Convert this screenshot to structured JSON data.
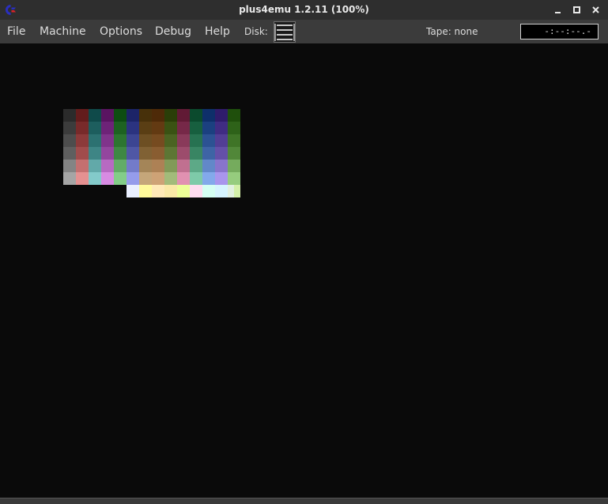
{
  "window": {
    "title": "plus4emu 1.2.11 (100%)",
    "app_icon": "commodore-logo-icon",
    "buttons": [
      "minimize-icon",
      "maximize-icon",
      "close-icon"
    ]
  },
  "menu": {
    "items": [
      {
        "label": "File"
      },
      {
        "label": "Machine"
      },
      {
        "label": "Options"
      },
      {
        "label": "Debug"
      },
      {
        "label": "Help"
      }
    ],
    "disk_label": "Disk:",
    "tape_label": "Tape: none",
    "tape_counter": "-:--:--.-"
  },
  "colors": {
    "titlebar": "#2e2e2e",
    "menubar": "#3b3b3b",
    "screen_background": "#0a0a0a"
  },
  "palette": {
    "rows": [
      [
        "#2b2b2b",
        "#631c1c",
        "#0f4a4a",
        "#5a1461",
        "#0d4d12",
        "#1c2468",
        "#47300a",
        "#4e2a08",
        "#2a3e08",
        "#611a35",
        "#0b4a2d",
        "#0e2f6a",
        "#2f1c6b",
        "#1f4f0c"
      ],
      [
        "#3c3c3c",
        "#782a2a",
        "#1d5e5e",
        "#6e2378",
        "#1d6221",
        "#2b3380",
        "#5a3e14",
        "#633a12",
        "#3a5213",
        "#762848",
        "#175f3f",
        "#1b4080",
        "#402c83",
        "#2e6219"
      ],
      [
        "#4d4d4d",
        "#8c3a3a",
        "#2c7171",
        "#80348b",
        "#2c7530",
        "#3c4592",
        "#6d4f23",
        "#764b20",
        "#4b6322",
        "#893a5a",
        "#277251",
        "#2c5293",
        "#523e95",
        "#3f7427"
      ],
      [
        "#5f5f5f",
        "#a04c4c",
        "#3e8585",
        "#93469e",
        "#3e8843",
        "#4f57a5",
        "#806134",
        "#895d31",
        "#5d7634",
        "#9c4c6c",
        "#398563",
        "#3e64a5",
        "#6450a8",
        "#518739"
      ],
      [
        "#848484",
        "#c47070",
        "#62a9a9",
        "#b76ac2",
        "#62ac66",
        "#737bc9",
        "#a48558",
        "#ad8155",
        "#819a58",
        "#c07090",
        "#5da987",
        "#6288c9",
        "#8874cc",
        "#75ab5d"
      ],
      [
        "#a5a5a5",
        "#e59191",
        "#83caca",
        "#d88be3",
        "#83cd88",
        "#959ceb",
        "#c5a67a",
        "#cea276",
        "#a2bb7a",
        "#e191b1",
        "#7ecaa9",
        "#83a9eb",
        "#a995ed",
        "#96cc7e"
      ],
      [
        "",
        "",
        "",
        "",
        "",
        "#eaf0ff",
        "#fffa9b",
        "#ffe9b7",
        "#fae9a6",
        "#edff97",
        "#ffdcf0",
        "#d5fff3",
        "#d6f4ff",
        "#e2f0e0"
      ]
    ],
    "last_row_extra": "#d4f0a9"
  }
}
